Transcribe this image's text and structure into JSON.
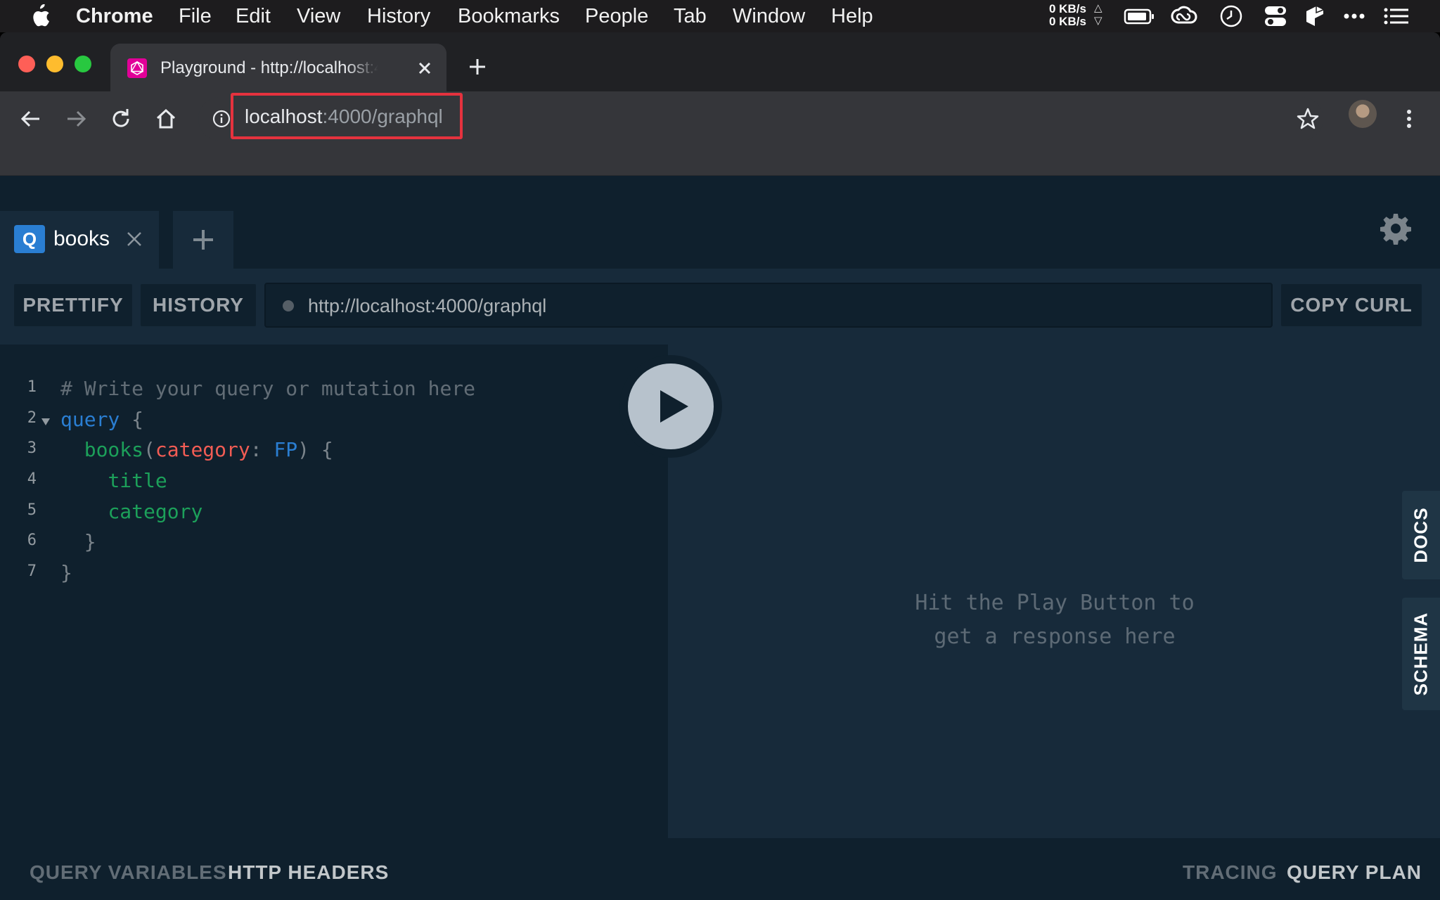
{
  "menubar": {
    "items": [
      "Chrome",
      "File",
      "Edit",
      "View",
      "History",
      "Bookmarks",
      "People",
      "Tab",
      "Window",
      "Help"
    ],
    "net_up": "0 KB/s",
    "net_down": "0 KB/s"
  },
  "browser": {
    "tab_title": "Playground - http://localhost:4000/graphql",
    "url_host": "localhost",
    "url_rest": ":4000/graphql"
  },
  "playground": {
    "tab": {
      "badge": "Q",
      "name": "books"
    },
    "buttons": {
      "prettify": "PRETTIFY",
      "history": "HISTORY",
      "copy_curl": "COPY CURL"
    },
    "endpoint": "http://localhost:4000/graphql",
    "line_numbers": [
      "1",
      "2",
      "3",
      "4",
      "5",
      "6",
      "7"
    ],
    "code": {
      "comment": "# Write your query or mutation here",
      "query_kw": "query",
      "open_brace": "{",
      "books_field": "books",
      "paren_open": "(",
      "arg_name": "category",
      "colon": ":",
      "arg_value": "FP",
      "paren_close": ")",
      "title_field": "title",
      "category_field": "category",
      "close_brace_inner": "}",
      "close_brace_outer": "}"
    },
    "result_placeholder_line1": "Hit the Play Button to",
    "result_placeholder_line2": "get a response here",
    "side_tabs": {
      "docs": "DOCS",
      "schema": "SCHEMA"
    },
    "bottom": {
      "query_variables": "QUERY VARIABLES",
      "http_headers": "HTTP HEADERS",
      "tracing": "TRACING",
      "query_plan": "QUERY PLAN"
    }
  },
  "colors": {
    "keyword": "#2a7ed2",
    "field": "#1ca05a",
    "argument": "#f25c54",
    "graphql_brand": "#e10098",
    "highlight_box": "#e5323e"
  },
  "icons": [
    "apple-icon",
    "graphql-favicon",
    "back-arrow-icon",
    "forward-arrow-icon",
    "reload-icon",
    "home-icon",
    "info-icon",
    "star-icon",
    "kebab-menu-icon",
    "settings-gear-icon",
    "play-icon",
    "plus-icon",
    "close-icon"
  ]
}
